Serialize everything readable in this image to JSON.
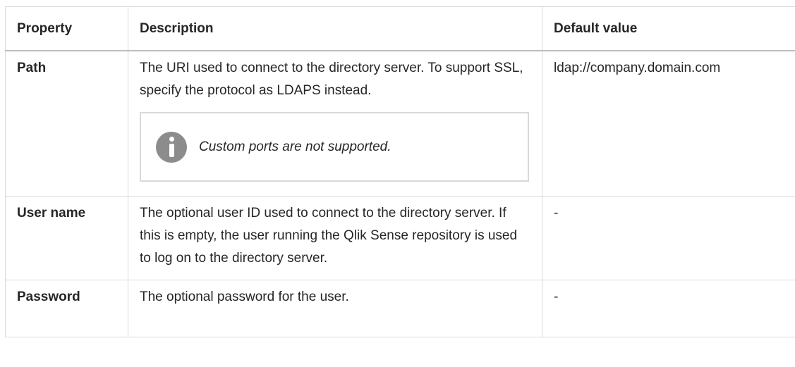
{
  "table": {
    "headers": [
      "Property",
      "Description",
      "Default value"
    ],
    "rows": [
      {
        "property": "Path",
        "description": "The URI used to connect to the directory server. To support SSL, specify the protocol as LDAPS instead.",
        "note": "Custom ports are not supported.",
        "default": "ldap://company.domain.com"
      },
      {
        "property": "User name",
        "description": "The optional user ID used to connect to the directory server. If this is empty, the user running the Qlik Sense repository is used to log on to the directory server.",
        "default": "-"
      },
      {
        "property": "Password",
        "description": "The optional password for the user.",
        "default": "-"
      }
    ]
  },
  "note_icon": "info-icon",
  "colors": {
    "border": "#d9d9d9",
    "icon": "#8c8c8c",
    "text": "#262626"
  }
}
